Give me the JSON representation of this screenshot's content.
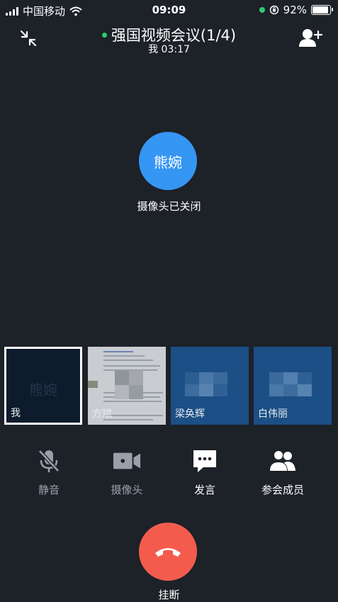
{
  "status_bar": {
    "carrier": "中国移动",
    "time": "09:09",
    "battery": "92%",
    "battery_level": 0.92
  },
  "header": {
    "title": "强国视频会议(1/4)",
    "subtitle": "我 03:17"
  },
  "main_speaker": {
    "name": "熊婉",
    "status": "摄像头已关闭",
    "avatar_color": "#3596f3"
  },
  "participants": [
    {
      "label": "我",
      "watermark": "熊婉",
      "selected": true
    },
    {
      "label": "方斌"
    },
    {
      "label": "梁奂辉"
    },
    {
      "label": "白伟丽"
    }
  ],
  "controls": [
    {
      "label": "静音",
      "icon": "mic-off-icon"
    },
    {
      "label": "摄像头",
      "icon": "video-camera-icon"
    },
    {
      "label": "发言",
      "icon": "chat-bubble-icon"
    },
    {
      "label": "参会成员",
      "icon": "members-icon"
    }
  ],
  "hangup": {
    "label": "挂断",
    "color": "#f35c4c"
  }
}
